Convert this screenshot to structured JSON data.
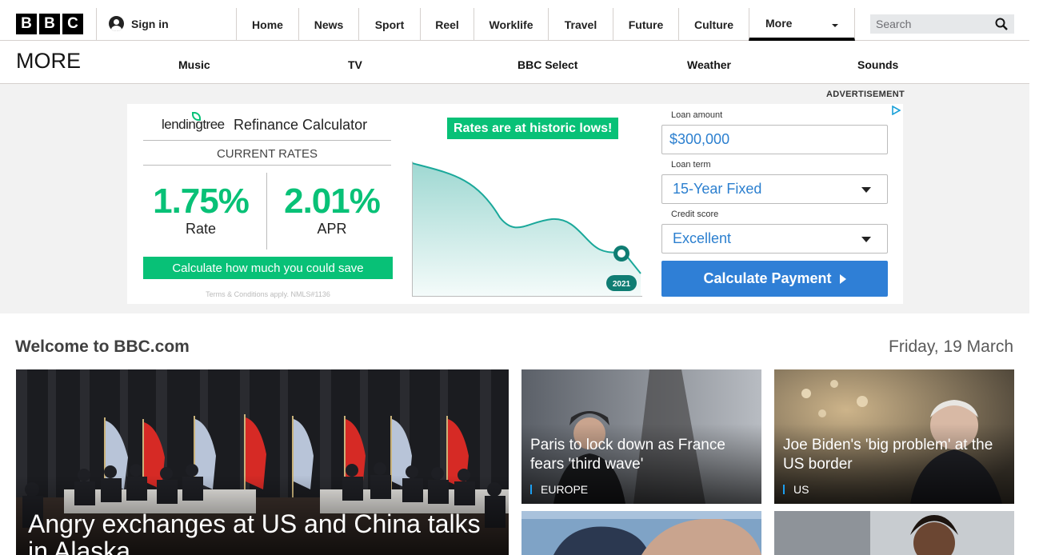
{
  "header": {
    "logo_letters": [
      "B",
      "B",
      "C"
    ],
    "sign_in": "Sign in",
    "nav": [
      "Home",
      "News",
      "Sport",
      "Reel",
      "Worklife",
      "Travel",
      "Future",
      "Culture"
    ],
    "more": "More",
    "search_placeholder": "Search"
  },
  "subnav": {
    "title": "MORE",
    "items": [
      "Music",
      "TV",
      "BBC Select",
      "Weather",
      "Sounds"
    ]
  },
  "ad": {
    "label": "ADVERTISEMENT",
    "brand": "lendingtree",
    "title": "Refinance Calculator",
    "current_rates": "CURRENT RATES",
    "rate_value": "1.75%",
    "rate_label": "Rate",
    "apr_value": "2.01%",
    "apr_label": "APR",
    "cta_bar": "Calculate how much you could save",
    "terms": "Terms & Conditions apply. NMLS#1136",
    "banner": "Rates are at historic lows!",
    "chart_year": "2021",
    "loan_amount_label": "Loan amount",
    "loan_amount_value": "$300,000",
    "loan_term_label": "Loan term",
    "loan_term_value": "15-Year Fixed",
    "credit_label": "Credit score",
    "credit_value": "Excellent",
    "button": "Calculate Payment",
    "colors": {
      "green": "#08c177",
      "blue": "#2f7fd6",
      "teal": "#1aa89a"
    }
  },
  "main": {
    "welcome": "Welcome to BBC.com",
    "date": "Friday, 19 March",
    "stories": [
      {
        "headline": "Angry exchanges at US and China talks in Alaska",
        "tag": ""
      },
      {
        "headline": "Paris to lock down as France fears 'third wave'",
        "tag": "EUROPE"
      },
      {
        "headline": "Joe Biden's 'big problem' at the US border",
        "tag": "US"
      }
    ]
  }
}
